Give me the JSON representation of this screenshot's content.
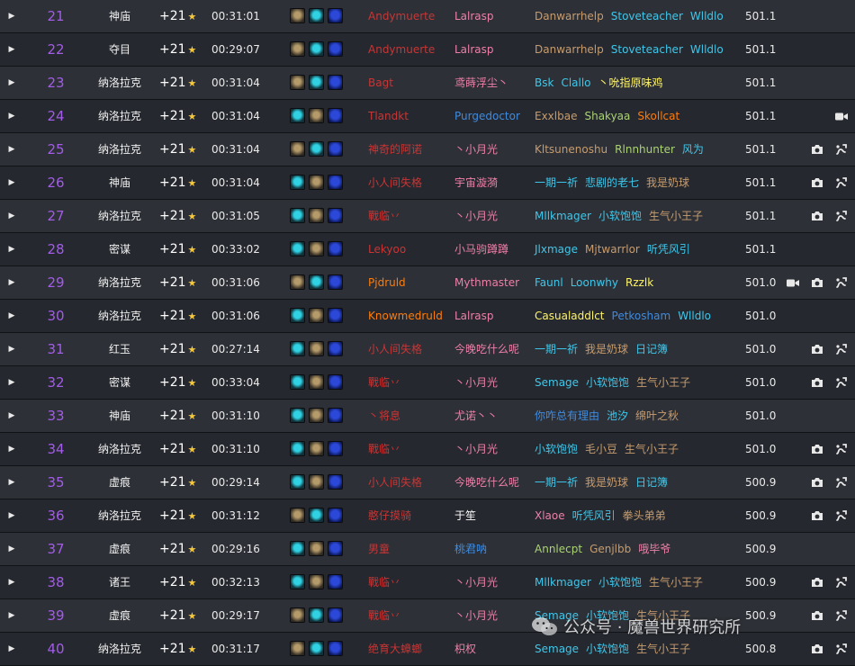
{
  "rows": [
    {
      "rank": "21",
      "dungeon": "神庙",
      "level": "+21",
      "time": "00:31:01",
      "affixes": [
        "fort",
        "tyr",
        "sea"
      ],
      "tank": {
        "name": "Andymuerte",
        "color": "#c93535"
      },
      "healer": {
        "name": "Lalrasp",
        "color": "#ee7fa9"
      },
      "dps": [
        {
          "name": "Danwarrhelp",
          "color": "#c79c6e"
        },
        {
          "name": "Stoveteacher",
          "color": "#3fc7eb"
        },
        {
          "name": "Wlldlo",
          "color": "#3fc7eb"
        }
      ],
      "score": "501.1",
      "icons": []
    },
    {
      "rank": "22",
      "dungeon": "夺目",
      "level": "+21",
      "time": "00:29:07",
      "affixes": [
        "fort",
        "tyr",
        "sea"
      ],
      "tank": {
        "name": "Andymuerte",
        "color": "#c93535"
      },
      "healer": {
        "name": "Lalrasp",
        "color": "#ee7fa9"
      },
      "dps": [
        {
          "name": "Danwarrhelp",
          "color": "#c79c6e"
        },
        {
          "name": "Stoveteacher",
          "color": "#3fc7eb"
        },
        {
          "name": "Wlldlo",
          "color": "#3fc7eb"
        }
      ],
      "score": "501.1",
      "icons": []
    },
    {
      "rank": "23",
      "dungeon": "纳洛拉克",
      "level": "+21",
      "time": "00:31:04",
      "affixes": [
        "fort",
        "tyr",
        "sea"
      ],
      "tank": {
        "name": "Bagt",
        "color": "#c93535"
      },
      "healer": {
        "name": "鸢蒔浮尘丶",
        "color": "#ee7fa9"
      },
      "dps": [
        {
          "name": "Bsk",
          "color": "#3fc7eb"
        },
        {
          "name": "Clallo",
          "color": "#3fc7eb"
        },
        {
          "name": "丶吮指原味鸡",
          "color": "#fff468"
        }
      ],
      "score": "501.1",
      "icons": []
    },
    {
      "rank": "24",
      "dungeon": "纳洛拉克",
      "level": "+21",
      "time": "00:31:04",
      "affixes": [
        "tyr",
        "fort",
        "sea"
      ],
      "tank": {
        "name": "Tlandkt",
        "color": "#c93535"
      },
      "healer": {
        "name": "Purgedoctor",
        "color": "#3f8be0"
      },
      "dps": [
        {
          "name": "Exxlbae",
          "color": "#c79c6e"
        },
        {
          "name": "Shakyaa",
          "color": "#aad372"
        },
        {
          "name": "Skollcat",
          "color": "#ff7c0a"
        }
      ],
      "score": "501.1",
      "icons": [
        "video"
      ]
    },
    {
      "rank": "25",
      "dungeon": "纳洛拉克",
      "level": "+21",
      "time": "00:31:04",
      "affixes": [
        "fort",
        "tyr",
        "sea"
      ],
      "tank": {
        "name": "神奇的阿诺",
        "color": "#c93535"
      },
      "healer": {
        "name": "丶小月光",
        "color": "#ee7fa9"
      },
      "dps": [
        {
          "name": "Kltsunenoshu",
          "color": "#c79c6e"
        },
        {
          "name": "Rlnnhunter",
          "color": "#aad372"
        },
        {
          "name": "风为",
          "color": "#3fc7eb"
        }
      ],
      "score": "501.1",
      "icons": [
        "camera",
        "chart"
      ]
    },
    {
      "rank": "26",
      "dungeon": "神庙",
      "level": "+21",
      "time": "00:31:04",
      "affixes": [
        "tyr",
        "fort",
        "sea"
      ],
      "tank": {
        "name": "小人间失格",
        "color": "#c93535"
      },
      "healer": {
        "name": "宇宙漩漪",
        "color": "#ee7fa9"
      },
      "dps": [
        {
          "name": "一期一祈",
          "color": "#3fc7eb"
        },
        {
          "name": "悲剧的老七",
          "color": "#3fc7eb"
        },
        {
          "name": "我是奶球",
          "color": "#c79c6e"
        }
      ],
      "score": "501.1",
      "icons": [
        "camera",
        "chart"
      ]
    },
    {
      "rank": "27",
      "dungeon": "纳洛拉克",
      "level": "+21",
      "time": "00:31:05",
      "affixes": [
        "tyr",
        "fort",
        "sea"
      ],
      "tank": {
        "name": "戰临丷",
        "color": "#c93535"
      },
      "healer": {
        "name": "丶小月光",
        "color": "#ee7fa9"
      },
      "dps": [
        {
          "name": "Mllkmager",
          "color": "#3fc7eb"
        },
        {
          "name": "小软饱饱",
          "color": "#3fc7eb"
        },
        {
          "name": "生气小王子",
          "color": "#c79c6e"
        }
      ],
      "score": "501.1",
      "icons": [
        "camera",
        "chart"
      ]
    },
    {
      "rank": "28",
      "dungeon": "密谋",
      "level": "+21",
      "time": "00:33:02",
      "affixes": [
        "tyr",
        "fort",
        "sea"
      ],
      "tank": {
        "name": "Lekyoo",
        "color": "#c93535"
      },
      "healer": {
        "name": "小马驹蹲蹲",
        "color": "#ee7fa9"
      },
      "dps": [
        {
          "name": "Jlxmage",
          "color": "#3fc7eb"
        },
        {
          "name": "Mjtwarrlor",
          "color": "#c79c6e"
        },
        {
          "name": "听凭风引",
          "color": "#3fc7eb"
        }
      ],
      "score": "501.1",
      "icons": []
    },
    {
      "rank": "29",
      "dungeon": "纳洛拉克",
      "level": "+21",
      "time": "00:31:06",
      "affixes": [
        "fort",
        "tyr",
        "sea"
      ],
      "tank": {
        "name": "Pjdruld",
        "color": "#ff7c0a"
      },
      "healer": {
        "name": "Mythmaster",
        "color": "#ee7fa9"
      },
      "dps": [
        {
          "name": "Faunl",
          "color": "#3fc7eb"
        },
        {
          "name": "Loonwhy",
          "color": "#3fc7eb"
        },
        {
          "name": "Rzzlk",
          "color": "#fff468"
        }
      ],
      "score": "501.0",
      "icons": [
        "video",
        "camera",
        "chart"
      ]
    },
    {
      "rank": "30",
      "dungeon": "纳洛拉克",
      "level": "+21",
      "time": "00:31:06",
      "affixes": [
        "tyr",
        "fort",
        "sea"
      ],
      "tank": {
        "name": "Knowmedruld",
        "color": "#ff7c0a"
      },
      "healer": {
        "name": "Lalrasp",
        "color": "#ee7fa9"
      },
      "dps": [
        {
          "name": "Casualaddlct",
          "color": "#fff468"
        },
        {
          "name": "Petkosham",
          "color": "#3f8be0"
        },
        {
          "name": "Wlldlo",
          "color": "#3fc7eb"
        }
      ],
      "score": "501.0",
      "icons": []
    },
    {
      "rank": "31",
      "dungeon": "红玉",
      "level": "+21",
      "time": "00:27:14",
      "affixes": [
        "tyr",
        "fort",
        "sea"
      ],
      "tank": {
        "name": "小人间失格",
        "color": "#c93535"
      },
      "healer": {
        "name": "今晚吃什么呢",
        "color": "#ee7fa9"
      },
      "dps": [
        {
          "name": "一期一祈",
          "color": "#3fc7eb"
        },
        {
          "name": "我是奶球",
          "color": "#c79c6e"
        },
        {
          "name": "日记簿",
          "color": "#3fc7eb"
        }
      ],
      "score": "501.0",
      "icons": [
        "camera",
        "chart"
      ]
    },
    {
      "rank": "32",
      "dungeon": "密谋",
      "level": "+21",
      "time": "00:33:04",
      "affixes": [
        "tyr",
        "fort",
        "sea"
      ],
      "tank": {
        "name": "戰临丷",
        "color": "#c93535"
      },
      "healer": {
        "name": "丶小月光",
        "color": "#ee7fa9"
      },
      "dps": [
        {
          "name": "Semage",
          "color": "#3fc7eb"
        },
        {
          "name": "小软饱饱",
          "color": "#3fc7eb"
        },
        {
          "name": "生气小王子",
          "color": "#c79c6e"
        }
      ],
      "score": "501.0",
      "icons": [
        "camera",
        "chart"
      ]
    },
    {
      "rank": "33",
      "dungeon": "神庙",
      "level": "+21",
      "time": "00:31:10",
      "affixes": [
        "tyr",
        "fort",
        "sea"
      ],
      "tank": {
        "name": "丶将息",
        "color": "#c93535"
      },
      "healer": {
        "name": "尤诺丶丶",
        "color": "#ee7fa9"
      },
      "dps": [
        {
          "name": "你咋总有理由",
          "color": "#3f8be0"
        },
        {
          "name": "池汐",
          "color": "#3fc7eb"
        },
        {
          "name": "绵叶之秋",
          "color": "#c79c6e"
        }
      ],
      "score": "501.0",
      "icons": []
    },
    {
      "rank": "34",
      "dungeon": "纳洛拉克",
      "level": "+21",
      "time": "00:31:10",
      "affixes": [
        "tyr",
        "fort",
        "sea"
      ],
      "tank": {
        "name": "戰临丷",
        "color": "#c93535"
      },
      "healer": {
        "name": "丶小月光",
        "color": "#ee7fa9"
      },
      "dps": [
        {
          "name": "小软饱饱",
          "color": "#3fc7eb"
        },
        {
          "name": "毛小豆",
          "color": "#c79c6e"
        },
        {
          "name": "生气小王子",
          "color": "#c79c6e"
        }
      ],
      "score": "501.0",
      "icons": [
        "camera",
        "chart"
      ]
    },
    {
      "rank": "35",
      "dungeon": "虚痕",
      "level": "+21",
      "time": "00:29:14",
      "affixes": [
        "tyr",
        "fort",
        "sea"
      ],
      "tank": {
        "name": "小人间失格",
        "color": "#c93535"
      },
      "healer": {
        "name": "今晚吃什么呢",
        "color": "#ee7fa9"
      },
      "dps": [
        {
          "name": "一期一祈",
          "color": "#3fc7eb"
        },
        {
          "name": "我是奶球",
          "color": "#c79c6e"
        },
        {
          "name": "日记簿",
          "color": "#3fc7eb"
        }
      ],
      "score": "500.9",
      "icons": [
        "camera",
        "chart"
      ]
    },
    {
      "rank": "36",
      "dungeon": "纳洛拉克",
      "level": "+21",
      "time": "00:31:12",
      "affixes": [
        "fort",
        "tyr",
        "sea"
      ],
      "tank": {
        "name": "憨仔摸骑",
        "color": "#c93535"
      },
      "healer": {
        "name": "于笙",
        "color": "#ffffff"
      },
      "dps": [
        {
          "name": "Xlaoe",
          "color": "#ee7fa9"
        },
        {
          "name": "听凭风引",
          "color": "#3fc7eb"
        },
        {
          "name": "拳头弟弟",
          "color": "#c79c6e"
        }
      ],
      "score": "500.9",
      "icons": [
        "camera",
        "chart"
      ]
    },
    {
      "rank": "37",
      "dungeon": "虚痕",
      "level": "+21",
      "time": "00:29:16",
      "affixes": [
        "tyr",
        "fort",
        "sea"
      ],
      "tank": {
        "name": "男童",
        "color": "#c93535"
      },
      "healer": {
        "name": "桃君呐",
        "color": "#3f8be0"
      },
      "dps": [
        {
          "name": "Annlecpt",
          "color": "#aad372"
        },
        {
          "name": "Genjlbb",
          "color": "#c79c6e"
        },
        {
          "name": "哦毕爷",
          "color": "#ee7fa9"
        }
      ],
      "score": "500.9",
      "icons": []
    },
    {
      "rank": "38",
      "dungeon": "诸王",
      "level": "+21",
      "time": "00:32:13",
      "affixes": [
        "tyr",
        "fort",
        "sea"
      ],
      "tank": {
        "name": "戰临丷",
        "color": "#c93535"
      },
      "healer": {
        "name": "丶小月光",
        "color": "#ee7fa9"
      },
      "dps": [
        {
          "name": "Mllkmager",
          "color": "#3fc7eb"
        },
        {
          "name": "小软饱饱",
          "color": "#3fc7eb"
        },
        {
          "name": "生气小王子",
          "color": "#c79c6e"
        }
      ],
      "score": "500.9",
      "icons": [
        "camera",
        "chart"
      ]
    },
    {
      "rank": "39",
      "dungeon": "虚痕",
      "level": "+21",
      "time": "00:29:17",
      "affixes": [
        "fort",
        "tyr",
        "sea"
      ],
      "tank": {
        "name": "戰临丷",
        "color": "#c93535"
      },
      "healer": {
        "name": "丶小月光",
        "color": "#ee7fa9"
      },
      "dps": [
        {
          "name": "Semage",
          "color": "#3fc7eb"
        },
        {
          "name": "小软饱饱",
          "color": "#3fc7eb"
        },
        {
          "name": "生气小王子",
          "color": "#c79c6e"
        }
      ],
      "score": "500.9",
      "icons": [
        "camera",
        "chart"
      ]
    },
    {
      "rank": "40",
      "dungeon": "纳洛拉克",
      "level": "+21",
      "time": "00:31:17",
      "affixes": [
        "fort",
        "tyr",
        "sea"
      ],
      "tank": {
        "name": "绝育大蟑螂",
        "color": "#c93535"
      },
      "healer": {
        "name": "枳权",
        "color": "#ee7fa9"
      },
      "dps": [
        {
          "name": "Semage",
          "color": "#3fc7eb"
        },
        {
          "name": "小软饱饱",
          "color": "#3fc7eb"
        },
        {
          "name": "生气小王子",
          "color": "#c79c6e"
        }
      ],
      "score": "500.8",
      "icons": [
        "camera",
        "chart"
      ]
    }
  ],
  "watermark": {
    "text": "公众号 · 魔兽世界研究所",
    "icon": "wechat-logo-icon"
  },
  "colors": {
    "rank": "#a35ce8",
    "star": "#f5c842",
    "row_odd": "#2d3036",
    "row_even": "#25282e"
  }
}
